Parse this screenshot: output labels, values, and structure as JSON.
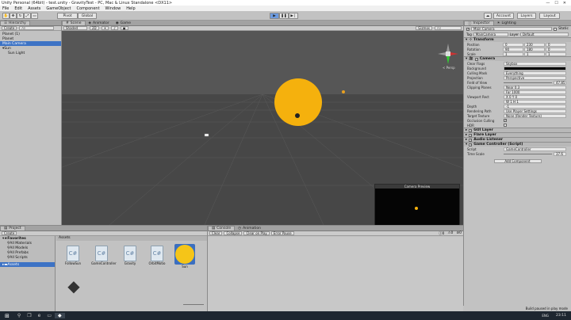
{
  "window": {
    "title": "Unity Personal (64bit) - test.unity - GravityTest - PC, Mac & Linux Standalone <DX11>",
    "min": "—",
    "max": "☐",
    "close": "✕"
  },
  "menu": [
    "File",
    "Edit",
    "Assets",
    "GameObject",
    "Component",
    "Window",
    "Help"
  ],
  "toolbar": {
    "pivot": "Pivot",
    "global": "Global",
    "layers": "Layers",
    "layout": "Layout",
    "account": "Account"
  },
  "hierarchy": {
    "tab": "Hierarchy",
    "create": "Create",
    "search_placeholder": "All",
    "items": [
      {
        "label": "Planet (1)",
        "indent": 0,
        "selected": false
      },
      {
        "label": "Planet",
        "indent": 0,
        "selected": false
      },
      {
        "label": "Main Camera",
        "indent": 0,
        "selected": true
      },
      {
        "label": "Sun",
        "indent": 0,
        "selected": false
      },
      {
        "label": "Sun Light",
        "indent": 1,
        "selected": false
      }
    ]
  },
  "scene": {
    "tabs": [
      "Scene",
      "Animator",
      "Game"
    ],
    "shading": "Shaded",
    "mode_2d": "2D",
    "gizmos": "Gizmos",
    "search_placeholder": "All",
    "persp": "< Persp",
    "camera_preview_title": "Camera Preview",
    "colors": {
      "sun": "#f5b10d",
      "bg": "#4a4a4a"
    }
  },
  "inspector": {
    "tabs": [
      "Inspector",
      "Lighting"
    ],
    "name": "Main Camera",
    "static": "Static",
    "tag_label": "Tag",
    "tag_value": "MainCamera",
    "layer_label": "Layer",
    "layer_value": "Default",
    "transform": {
      "title": "Transform",
      "rows": [
        {
          "label": "Position",
          "x": "0",
          "y": "230",
          "z": "0"
        },
        {
          "label": "Rotation",
          "x": "90",
          "y": "180",
          "z": "0"
        },
        {
          "label": "Scale",
          "x": "1",
          "y": "1",
          "z": "1"
        }
      ]
    },
    "camera": {
      "title": "Camera",
      "rows": [
        {
          "label": "Clear Flags",
          "value": "Skybox"
        },
        {
          "label": "Background",
          "value": ""
        },
        {
          "label": "Culling Mask",
          "value": "Everything"
        },
        {
          "label": "Projection",
          "value": "Perspective"
        },
        {
          "label": "Field of View",
          "value": "47.85"
        },
        {
          "label": "Clipping Planes",
          "value": "Near 0.3"
        },
        {
          "label": "",
          "value": "Far 1000"
        },
        {
          "label": "Viewport Rect",
          "value": "X 0   Y 0"
        },
        {
          "label": "",
          "value": "W 1   H 1"
        },
        {
          "label": "Depth",
          "value": "-1"
        },
        {
          "label": "Rendering Path",
          "value": "Use Player Settings"
        },
        {
          "label": "Target Texture",
          "value": "None (Render Texture)"
        },
        {
          "label": "Occlusion Culling",
          "value": "✓"
        },
        {
          "label": "HDR",
          "value": ""
        }
      ]
    },
    "components": [
      "GUI Layer",
      "Flare Layer",
      "Audio Listener"
    ],
    "script": {
      "title": "Game Controller (Script)",
      "script_label": "Script",
      "script_value": "GameController",
      "time_label": "Time Scale",
      "time_value": "37.6"
    },
    "add_component": "Add Component"
  },
  "project": {
    "tab": "Project",
    "create": "Create",
    "favorites": "Favorites",
    "fav_items": [
      "All Materials",
      "All Models",
      "All Prefabs",
      "All Scripts"
    ],
    "assets_folder": "Assets",
    "assets_header": "Assets",
    "assets": [
      {
        "name": "FollowSun"
      },
      {
        "name": "GameController"
      },
      {
        "name": "Gravity"
      },
      {
        "name": "OrbitMotio"
      },
      {
        "name": "Sun"
      }
    ]
  },
  "console": {
    "tabs": [
      "Console",
      "Animation"
    ],
    "buttons": [
      "Clear",
      "Collapse",
      "Clear on Play",
      "Error Pause"
    ],
    "counts": [
      "0",
      "0",
      "0"
    ]
  },
  "status": {
    "message": "Build paused in play mode"
  },
  "taskbar": {
    "time": "23:11",
    "lang": "ENG"
  }
}
